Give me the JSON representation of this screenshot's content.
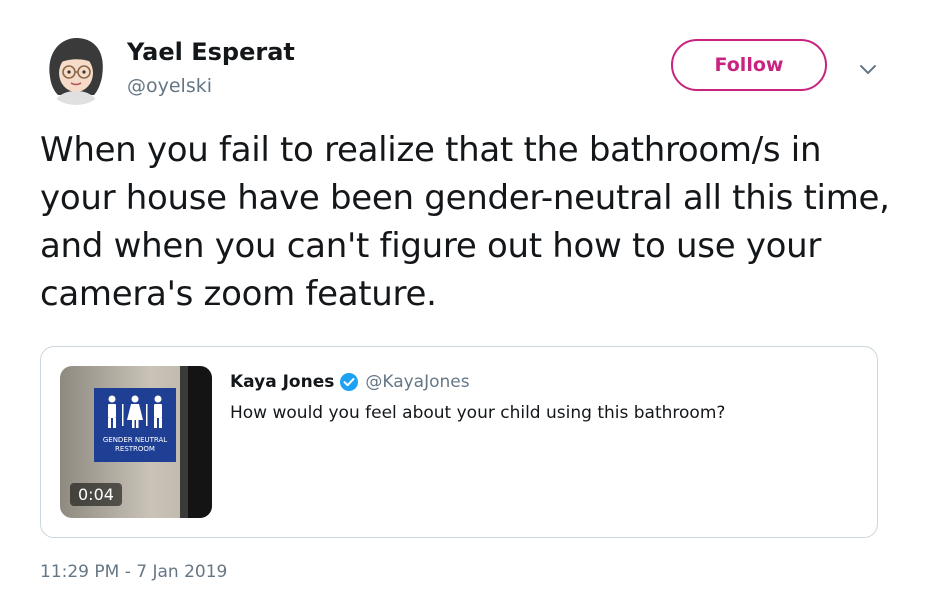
{
  "author": {
    "display_name": "Yael Esperat",
    "handle": "@oyelski",
    "avatar_icon": "cartoon-avatar-icon"
  },
  "actions": {
    "follow_label": "Follow",
    "more_icon": "chevron-down-icon"
  },
  "tweet": {
    "text": "When you fail to realize that the bathroom/s in your house have been gender-neutral all this time, and when you can't figure out how to use your camera's zoom feature.",
    "timestamp": "11:29 PM - 7 Jan 2019"
  },
  "quoted_tweet": {
    "display_name": "Kaya Jones",
    "handle": "@KayaJones",
    "verified_icon": "verified-badge-icon",
    "text": "How would you feel about your child using this bathroom?",
    "video_duration": "0:04",
    "sign_text_line1": "GENDER NEUTRAL",
    "sign_text_line2": "RESTROOM"
  },
  "colors": {
    "accent": "#c8247f",
    "verified": "#1da1f2",
    "secondary_text": "#657786",
    "border": "#ccd6dd",
    "sign_blue": "#1f3f95"
  }
}
